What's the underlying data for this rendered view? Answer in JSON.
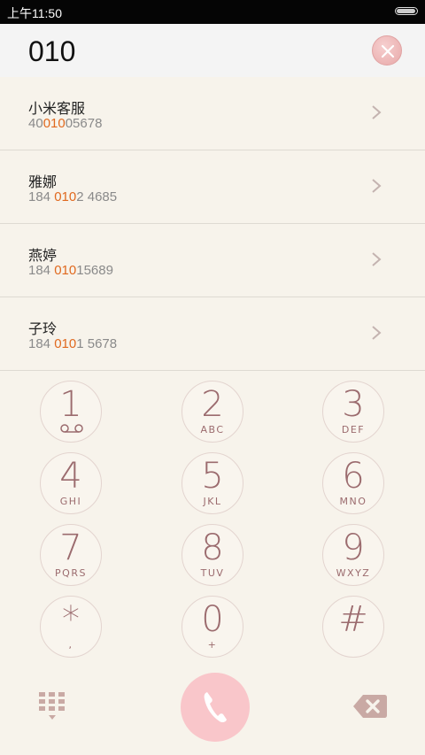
{
  "status_bar": {
    "time": "上午11:50",
    "battery_level": 1.0
  },
  "dialer": {
    "number": "010"
  },
  "contacts": [
    {
      "name": "小米客服",
      "number_pre": "40",
      "number_match": "010",
      "number_post": "05678"
    },
    {
      "name": "雅娜",
      "number_pre": "184 ",
      "number_match": "010",
      "number_post": "2 4685"
    },
    {
      "name": "燕婷",
      "number_pre": "184 ",
      "number_match": "010",
      "number_post": "15689"
    },
    {
      "name": "子玲",
      "number_pre": "184 ",
      "number_match": "010",
      "number_post": "1 5678"
    }
  ],
  "keypad": [
    {
      "digit": "1",
      "letters": ""
    },
    {
      "digit": "2",
      "letters": "ABC"
    },
    {
      "digit": "3",
      "letters": "DEF"
    },
    {
      "digit": "4",
      "letters": "GHI"
    },
    {
      "digit": "5",
      "letters": "JKL"
    },
    {
      "digit": "6",
      "letters": "MNO"
    },
    {
      "digit": "7",
      "letters": "PQRS"
    },
    {
      "digit": "8",
      "letters": "TUV"
    },
    {
      "digit": "9",
      "letters": "WXYZ"
    },
    {
      "digit": "*",
      "letters": ","
    },
    {
      "digit": "0",
      "letters": "+"
    },
    {
      "digit": "#",
      "letters": ""
    }
  ],
  "icons": {
    "clear": "close-icon",
    "voicemail": "voicemail-icon",
    "keypad_toggle": "keypad-grid-icon",
    "call": "phone-icon",
    "backspace": "backspace-icon",
    "chevron": "chevron-right-icon"
  },
  "colors": {
    "highlight": "#e0691f",
    "key_text": "#9b6b6e",
    "call_button": "#f9c6ca",
    "background": "#f7f3eb"
  }
}
